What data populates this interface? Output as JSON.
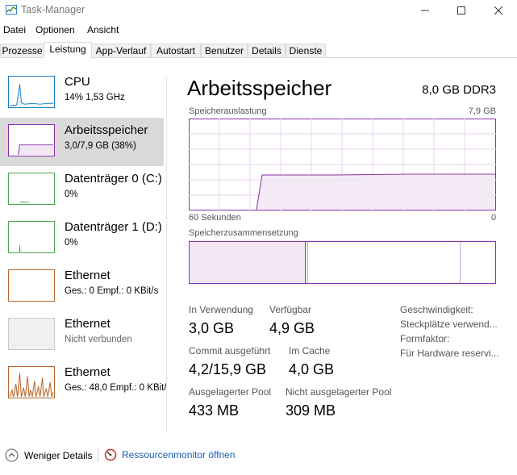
{
  "window": {
    "title": "Task-Manager"
  },
  "menu": [
    "Datei",
    "Optionen",
    "Ansicht"
  ],
  "tabs": [
    "Prozesse",
    "Leistung",
    "App-Verlauf",
    "Autostart",
    "Benutzer",
    "Details",
    "Dienste"
  ],
  "active_tab": "Leistung",
  "sidebar": [
    {
      "name": "CPU",
      "sub": "14%  1,53 GHz",
      "color": "#1a7fc0"
    },
    {
      "name": "Arbeitsspeicher",
      "sub": "3,0/7,9 GB (38%)",
      "color": "#8a2fa8"
    },
    {
      "name": "Datenträger 0 (C:)",
      "sub": "0%",
      "color": "#4ca64c"
    },
    {
      "name": "Datenträger 1 (D:)",
      "sub": "0%",
      "color": "#4ca64c"
    },
    {
      "name": "Ethernet",
      "sub": "Ges.: 0  Empf.: 0 KBit/s",
      "color": "#b8652b"
    },
    {
      "name": "Ethernet",
      "sub": "Nicht verbunden",
      "color": "#b0b0b0"
    },
    {
      "name": "Ethernet",
      "sub": "Ges.: 48,0  Empf.: 0 KBit/",
      "color": "#b8652b"
    }
  ],
  "main": {
    "title": "Arbeitsspeicher",
    "spec": "8,0 GB DDR3",
    "usage_label": "Speicherauslastung",
    "usage_max": "7,9 GB",
    "time_left": "60 Sekunden",
    "time_right": "0",
    "composition_label": "Speicherzusammensetzung",
    "stats": {
      "in_use_label": "In Verwendung",
      "in_use": "3,0 GB",
      "available_label": "Verfügbar",
      "available": "4,9 GB",
      "commit_label": "Commit ausgeführt",
      "commit": "4,2/15,9 GB",
      "cache_label": "Im Cache",
      "cache": "4,0 GB",
      "paged_label": "Ausgelagerter Pool",
      "paged": "433 MB",
      "nonpaged_label": "Nicht ausgelagerter Pool",
      "nonpaged": "309 MB"
    },
    "info": [
      "Geschwindigkeit:",
      "Steckplätze verwend...",
      "Formfaktor:",
      "Für Hardware reservi..."
    ]
  },
  "footer": {
    "less_details": "Weniger Details",
    "resource_monitor": "Ressourcenmonitor öffnen"
  }
}
